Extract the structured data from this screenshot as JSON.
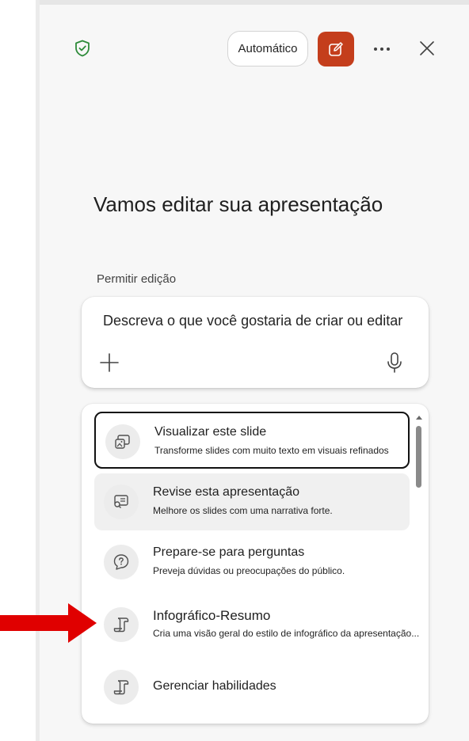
{
  "header": {
    "mode_label": "Automático",
    "icons": [
      "shield-check-icon",
      "compose-icon",
      "more-icon",
      "close-icon"
    ],
    "accent_color": "#c43e1c",
    "shield_color": "#2e8b3a"
  },
  "main": {
    "heading": "Vamos editar sua apresentação",
    "permission_label": "Permitir edição",
    "prompt": {
      "placeholder": "Descreva o que você gostaria de criar ou editar",
      "icons": [
        "plus-icon",
        "microphone-icon"
      ]
    }
  },
  "suggestions": [
    {
      "title": "Visualizar este slide",
      "description": "Transforme slides com muito texto em visuais refinados",
      "icon": "slide-image-icon",
      "state": "selected"
    },
    {
      "title": "Revise esta apresentação",
      "description": "Melhore os slides com uma narrativa forte.",
      "icon": "review-slides-icon",
      "state": "hover"
    },
    {
      "title": "Prepare-se para perguntas",
      "description": "Preveja dúvidas ou preocupações do público.",
      "icon": "question-chat-icon",
      "state": "normal"
    },
    {
      "title": "Infográfico-Resumo",
      "description": "Cria uma visão geral do estilo de infográfico da apresentação...",
      "icon": "scroll-icon",
      "state": "normal"
    },
    {
      "title": "Gerenciar habilidades",
      "description": "",
      "icon": "scroll-icon",
      "state": "normal"
    }
  ],
  "annotation": {
    "arrow_color": "#e00000"
  }
}
